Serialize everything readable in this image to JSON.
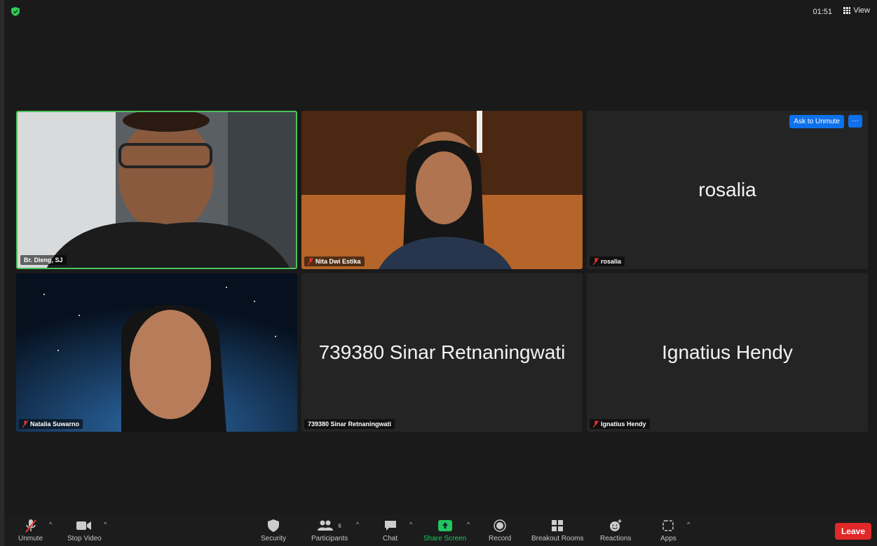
{
  "topbar": {
    "timer": "01:51",
    "view_label": "View"
  },
  "participants": [
    {
      "name": "Br. Dieng, SJ",
      "video": true,
      "active": true,
      "muted": false
    },
    {
      "name": "Nita Dwi Estika",
      "video": true,
      "active": false,
      "muted": true
    },
    {
      "name": "rosalia",
      "video": false,
      "active": false,
      "muted": true,
      "ask_unmute": "Ask to Unmute",
      "more": "···"
    },
    {
      "name": "Natalia Suwarno",
      "video": true,
      "active": false,
      "muted": true
    },
    {
      "name": "739380 Sinar Retnaningwati",
      "video": false,
      "active": false,
      "muted": false
    },
    {
      "name": "Ignatius Hendy",
      "video": false,
      "active": false,
      "muted": true
    }
  ],
  "toolbar": {
    "unmute": "Unmute",
    "stop_video": "Stop Video",
    "security": "Security",
    "participants": "Participants",
    "participants_count": "6",
    "chat": "Chat",
    "share_screen": "Share Screen",
    "record": "Record",
    "breakout_rooms": "Breakout Rooms",
    "reactions": "Reactions",
    "apps": "Apps",
    "leave": "Leave"
  },
  "colors": {
    "active_border": "#4cc35a",
    "accent_blue": "#0e71eb",
    "leave_red": "#e02828",
    "share_green": "#22c55e"
  }
}
